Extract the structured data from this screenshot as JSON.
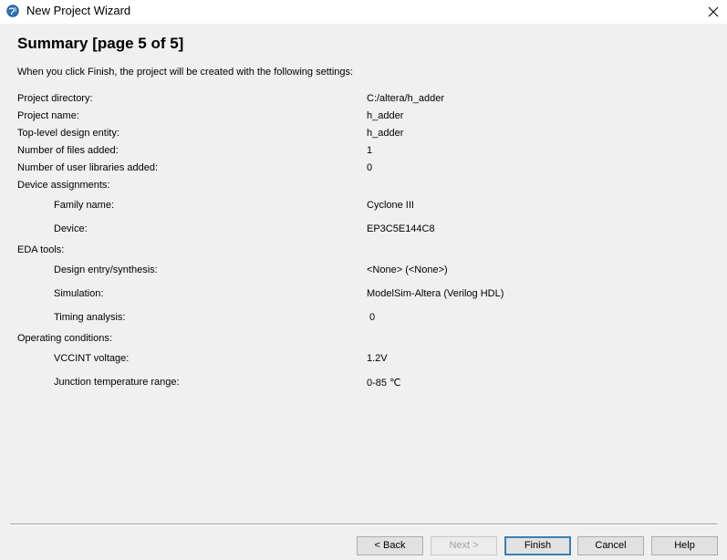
{
  "window": {
    "title": "New Project Wizard",
    "icon": "quartus-globe-icon",
    "close_glyph": "close-icon"
  },
  "page": {
    "heading": "Summary [page 5 of 5]",
    "intro": "When you click Finish, the project will be created with the following settings:"
  },
  "settings": {
    "project_directory": {
      "label": "Project directory:",
      "value": "C:/altera/h_adder"
    },
    "project_name": {
      "label": "Project name:",
      "value": "h_adder"
    },
    "top_level_entity": {
      "label": "Top-level design entity:",
      "value": "h_adder"
    },
    "files_added": {
      "label": "Number of files added:",
      "value": "1"
    },
    "user_libraries": {
      "label": "Number of user libraries added:",
      "value": "0"
    },
    "device_assignments": {
      "label": "Device assignments:",
      "family_name": {
        "label": "Family name:",
        "value": "Cyclone III"
      },
      "device": {
        "label": "Device:",
        "value": "EP3C5E144C8"
      }
    },
    "eda_tools": {
      "label": "EDA tools:",
      "design_entry": {
        "label": "Design entry/synthesis:",
        "value": "<None> (<None>)"
      },
      "simulation": {
        "label": "Simulation:",
        "value": "ModelSim-Altera (Verilog HDL)"
      },
      "timing_analysis": {
        "label": "Timing analysis:",
        "value": "0"
      }
    },
    "operating_conditions": {
      "label": "Operating conditions:",
      "vccint": {
        "label": "VCCINT voltage:",
        "value": "1.2V"
      },
      "junction_temp": {
        "label": "Junction temperature range:",
        "value": "0-85 ℃"
      }
    }
  },
  "buttons": {
    "back": "< Back",
    "next": "Next >",
    "finish": "Finish",
    "cancel": "Cancel",
    "help": "Help"
  }
}
